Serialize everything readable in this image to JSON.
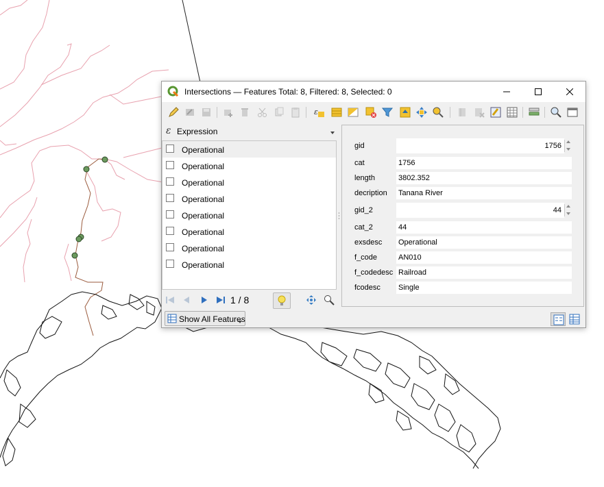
{
  "window": {
    "title": "Intersections — Features Total: 8, Filtered: 8, Selected: 0",
    "app_icon": "qgis-icon"
  },
  "toolbar": {
    "icons": [
      "toggle-editing-icon",
      "multi-edit-icon",
      "save-edits-icon",
      "add-feature-icon",
      "delete-feature-icon",
      "cut-icon",
      "copy-icon",
      "paste-icon",
      "select-by-expression-icon",
      "select-all-icon",
      "invert-selection-icon",
      "deselect-all-icon",
      "filter-select-icon",
      "move-selection-top-icon",
      "pan-to-selection-icon",
      "zoom-to-selection-icon",
      "new-field-icon",
      "delete-field-icon",
      "field-calculator-icon",
      "conditional-formatting-icon",
      "actions-icon",
      "zoom-map-to-features-icon",
      "dock-icon"
    ]
  },
  "left_pane": {
    "expression_label": "Expression",
    "features": [
      {
        "label": "Operational",
        "checked": false
      },
      {
        "label": "Operational",
        "checked": false
      },
      {
        "label": "Operational",
        "checked": false
      },
      {
        "label": "Operational",
        "checked": false
      },
      {
        "label": "Operational",
        "checked": false
      },
      {
        "label": "Operational",
        "checked": false
      },
      {
        "label": "Operational",
        "checked": false
      },
      {
        "label": "Operational",
        "checked": false
      }
    ],
    "page_counter": "1 / 8",
    "show_all_label": "Show All Features"
  },
  "form": {
    "fields": [
      {
        "label": "gid",
        "value": "1756",
        "type": "spin"
      },
      {
        "label": "cat",
        "value": "1756",
        "type": "text"
      },
      {
        "label": "length",
        "value": "3802.352",
        "type": "text"
      },
      {
        "label": "decription",
        "value": "Tanana River",
        "type": "text"
      },
      {
        "label": "gid_2",
        "value": "44",
        "type": "spin"
      },
      {
        "label": "cat_2",
        "value": "44",
        "type": "text"
      },
      {
        "label": "exsdesc",
        "value": "Operational",
        "type": "text"
      },
      {
        "label": "f_code",
        "value": "AN010",
        "type": "text"
      },
      {
        "label": "f_codedesc",
        "value": "Railroad",
        "type": "text"
      },
      {
        "label": "fcodesc",
        "value": "Single",
        "type": "text"
      }
    ]
  },
  "colors": {
    "river": "#e8a1ae",
    "railroad": "#9a5a3c",
    "point_fill": "#6c9a5e",
    "coastline": "#111111"
  }
}
